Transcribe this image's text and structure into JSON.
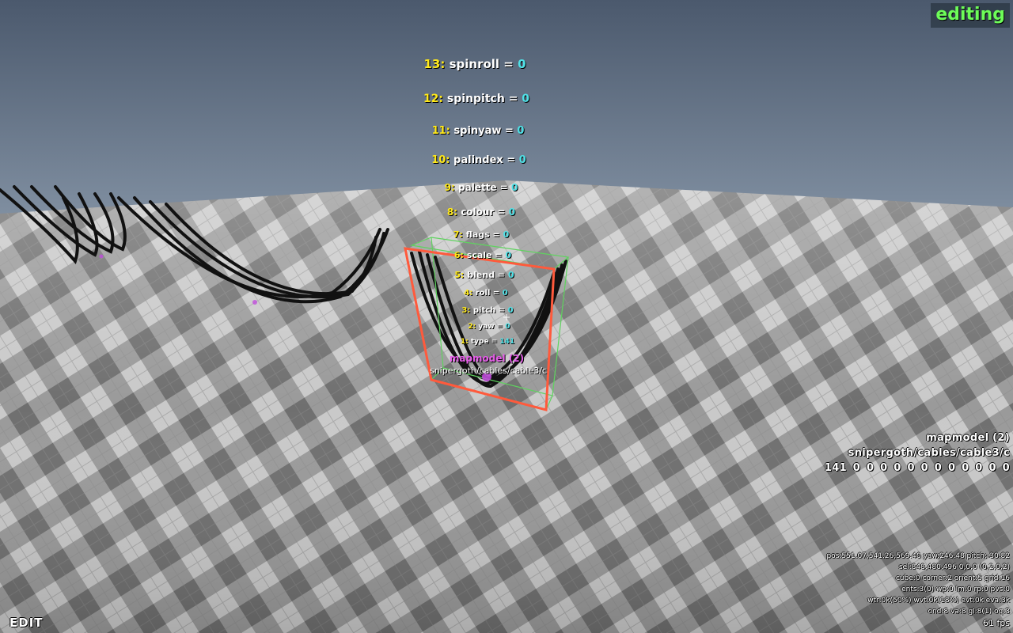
{
  "hud": {
    "mode_badge": "editing",
    "mode_label": "EDIT",
    "fps": "61 fps"
  },
  "entity": {
    "title": "mapmodel (2)",
    "path": "snipergoth/cables/cable3/c",
    "attributes": [
      {
        "index": "13:",
        "name": "spinroll",
        "value": "0"
      },
      {
        "index": "12:",
        "name": "spinpitch",
        "value": "0"
      },
      {
        "index": "11:",
        "name": "spinyaw",
        "value": "0"
      },
      {
        "index": "10:",
        "name": "palindex",
        "value": "0"
      },
      {
        "index": "9:",
        "name": "palette",
        "value": "0"
      },
      {
        "index": "8:",
        "name": "colour",
        "value": "0"
      },
      {
        "index": "7:",
        "name": "flags",
        "value": "0"
      },
      {
        "index": "6:",
        "name": "scale",
        "value": "0"
      },
      {
        "index": "5:",
        "name": "blend",
        "value": "0"
      },
      {
        "index": "4:",
        "name": "roll",
        "value": "0"
      },
      {
        "index": "3:",
        "name": "pitch",
        "value": "0"
      },
      {
        "index": "2:",
        "name": "yaw",
        "value": "0"
      },
      {
        "index": "1:",
        "name": "type",
        "value": "141"
      }
    ]
  },
  "selection_panel": {
    "title": "mapmodel (2)",
    "path": "snipergoth/cables/cable3/c",
    "values": "141 0 0 0 0 0 0 0 0 0 0 0 0"
  },
  "stats": {
    "line1": "pos:551.07,541.26,569.40 yaw:246.48 pitch:-30.82",
    "line2": "sel:848,480,496 0,0,0 (0,2,0,2)",
    "line3": "cube:0 corner:2 orient:5 grid:16",
    "line4": "ents:3(0) wp:0 lm:0 rp:0 pvs:0",
    "line5": "wtr:0k(50%) wvt:0k(18%) evt:0k eva:3k",
    "line6": "ond:8 va:8 gl:8(1) oq:3"
  },
  "colors": {
    "sky_top": "#4d5b70",
    "sky_horizon": "#7f8ea0",
    "selection_box": "#ff5a3c",
    "bounding_box": "#5fd35f",
    "entity_marker": "#c04ddc",
    "badge_text": "#6dfc58",
    "attr_index": "#ffe91a",
    "attr_value": "#4fe0e6",
    "entity_title": "#e55de8"
  }
}
